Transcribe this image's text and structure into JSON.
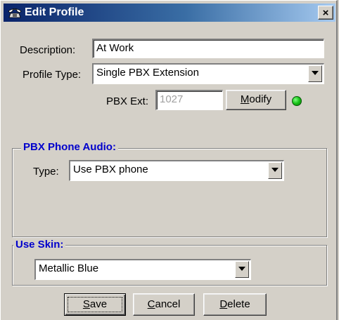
{
  "window": {
    "title": "Edit Profile",
    "close_label": "×"
  },
  "description": {
    "label": "Description:",
    "value": "At Work"
  },
  "profile_type": {
    "label": "Profile Type:",
    "selected": "Single PBX Extension"
  },
  "pbx_ext": {
    "label": "PBX Ext:",
    "value": "1027",
    "modify_label_u": "M",
    "modify_label_rest": "odify",
    "status_color": "#16c016"
  },
  "phone_audio": {
    "title": "PBX Phone Audio:",
    "type_label": "Type:",
    "selected": "Use PBX phone"
  },
  "skin": {
    "title": "Use Skin:",
    "selected": "Metallic Blue"
  },
  "buttons": {
    "save_u": "S",
    "save_rest": "ave",
    "cancel_u": "C",
    "cancel_rest": "ancel",
    "delete_u": "D",
    "delete_rest": "elete"
  },
  "icons": {
    "title": "phone-icon",
    "close": "close-icon",
    "dropdown": "chevron-down-icon",
    "status": "status-led-icon"
  }
}
